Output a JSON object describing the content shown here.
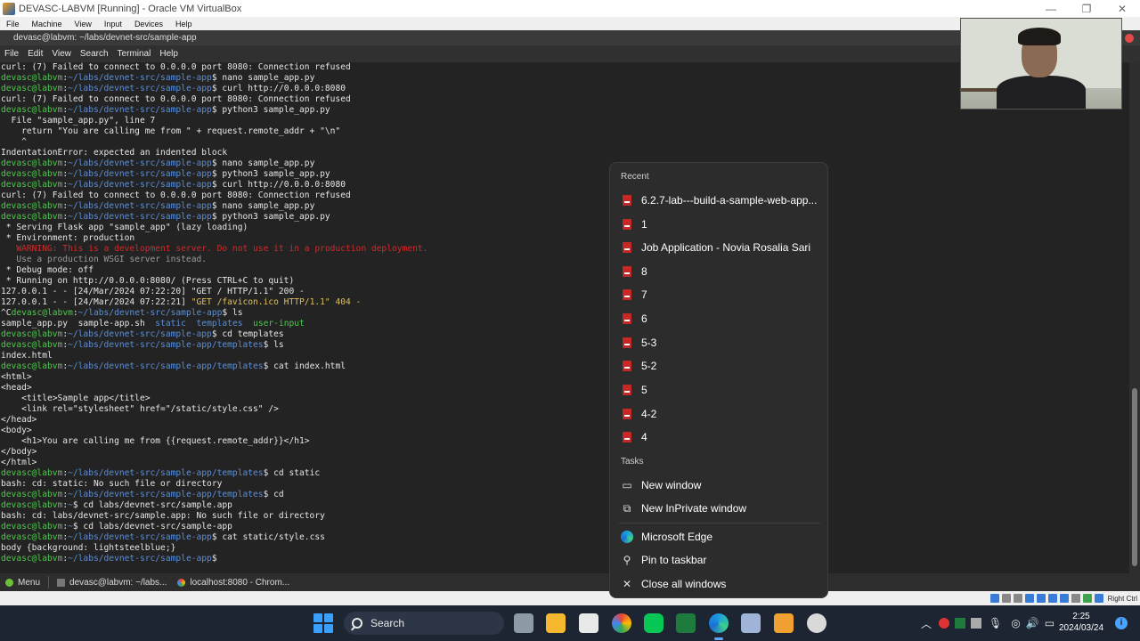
{
  "virtualbox": {
    "title": "DEVASC-LABVM [Running] - Oracle VM VirtualBox",
    "menu": [
      "File",
      "Machine",
      "View",
      "Input",
      "Devices",
      "Help"
    ],
    "host_key": "Right Ctrl"
  },
  "terminal": {
    "title": "devasc@labvm: ~/labs/devnet-src/sample-app",
    "menu": [
      "File",
      "Edit",
      "View",
      "Search",
      "Terminal",
      "Help"
    ],
    "lines": [
      [
        {
          "t": "curl: (7) Failed to connect to 0.0.0.0 port 8080: Connection refused",
          "c": ""
        }
      ],
      [
        {
          "t": "devasc@labvm",
          "c": "user"
        },
        {
          "t": ":",
          "c": ""
        },
        {
          "t": "~/labs/devnet-src/sample-app",
          "c": "path"
        },
        {
          "t": "$ nano sample_app.py",
          "c": ""
        }
      ],
      [
        {
          "t": "devasc@labvm",
          "c": "user"
        },
        {
          "t": ":",
          "c": ""
        },
        {
          "t": "~/labs/devnet-src/sample-app",
          "c": "path"
        },
        {
          "t": "$ curl http://0.0.0.0:8080",
          "c": ""
        }
      ],
      [
        {
          "t": "curl: (7) Failed to connect to 0.0.0.0 port 8080: Connection refused",
          "c": ""
        }
      ],
      [
        {
          "t": "devasc@labvm",
          "c": "user"
        },
        {
          "t": ":",
          "c": ""
        },
        {
          "t": "~/labs/devnet-src/sample-app",
          "c": "path"
        },
        {
          "t": "$ python3 sample_app.py",
          "c": ""
        }
      ],
      [
        {
          "t": "  File \"sample_app.py\", line 7",
          "c": ""
        }
      ],
      [
        {
          "t": "    return \"You are calling me from \" + request.remote_addr + \"\\n\"",
          "c": ""
        }
      ],
      [
        {
          "t": "    ^",
          "c": ""
        }
      ],
      [
        {
          "t": "IndentationError: expected an indented block",
          "c": ""
        }
      ],
      [
        {
          "t": "devasc@labvm",
          "c": "user"
        },
        {
          "t": ":",
          "c": ""
        },
        {
          "t": "~/labs/devnet-src/sample-app",
          "c": "path"
        },
        {
          "t": "$ nano sample_app.py",
          "c": ""
        }
      ],
      [
        {
          "t": "devasc@labvm",
          "c": "user"
        },
        {
          "t": ":",
          "c": ""
        },
        {
          "t": "~/labs/devnet-src/sample-app",
          "c": "path"
        },
        {
          "t": "$ python3 sample_app.py",
          "c": ""
        }
      ],
      [
        {
          "t": "devasc@labvm",
          "c": "user"
        },
        {
          "t": ":",
          "c": ""
        },
        {
          "t": "~/labs/devnet-src/sample-app",
          "c": "path"
        },
        {
          "t": "$ curl http://0.0.0.0:8080",
          "c": ""
        }
      ],
      [
        {
          "t": "curl: (7) Failed to connect to 0.0.0.0 port 8080: Connection refused",
          "c": ""
        }
      ],
      [
        {
          "t": "devasc@labvm",
          "c": "user"
        },
        {
          "t": ":",
          "c": ""
        },
        {
          "t": "~/labs/devnet-src/sample-app",
          "c": "path"
        },
        {
          "t": "$ nano sample_app.py",
          "c": ""
        }
      ],
      [
        {
          "t": "devasc@labvm",
          "c": "user"
        },
        {
          "t": ":",
          "c": ""
        },
        {
          "t": "~/labs/devnet-src/sample-app",
          "c": "path"
        },
        {
          "t": "$ python3 sample_app.py",
          "c": ""
        }
      ],
      [
        {
          "t": " * Serving Flask app \"sample_app\" (lazy loading)",
          "c": ""
        }
      ],
      [
        {
          "t": " * Environment: production",
          "c": ""
        }
      ],
      [
        {
          "t": "   WARNING: This is a development server. Do not use it in a production deployment.",
          "c": "warn"
        }
      ],
      [
        {
          "t": "   Use a production WSGI server instead.",
          "c": "dim"
        }
      ],
      [
        {
          "t": " * Debug mode: off",
          "c": ""
        }
      ],
      [
        {
          "t": " * Running on http://0.0.0.0:8080/ (Press CTRL+C to quit)",
          "c": ""
        }
      ],
      [
        {
          "t": "127.0.0.1 - - [24/Mar/2024 07:22:20] \"GET / HTTP/1.1\" 200 -",
          "c": ""
        }
      ],
      [
        {
          "t": "127.0.0.1 - - [24/Mar/2024 07:22:21] ",
          "c": ""
        },
        {
          "t": "\"GET /favicon.ico HTTP/1.1\" 404 -",
          "c": "404"
        }
      ],
      [
        {
          "t": "^C",
          "c": ""
        },
        {
          "t": "devasc@labvm",
          "c": "user"
        },
        {
          "t": ":",
          "c": ""
        },
        {
          "t": "~/labs/devnet-src/sample-app",
          "c": "path"
        },
        {
          "t": "$ ls",
          "c": ""
        }
      ],
      [
        {
          "t": "sample_app.py  ",
          "c": ""
        },
        {
          "t": "sample-app.sh",
          "c": ""
        },
        {
          "t": "  ",
          "c": ""
        },
        {
          "t": "static",
          "c": "dir"
        },
        {
          "t": "  ",
          "c": ""
        },
        {
          "t": "templates",
          "c": "dir"
        },
        {
          "t": "  ",
          "c": ""
        },
        {
          "t": "user-input",
          "c": "exe"
        }
      ],
      [
        {
          "t": "devasc@labvm",
          "c": "user"
        },
        {
          "t": ":",
          "c": ""
        },
        {
          "t": "~/labs/devnet-src/sample-app",
          "c": "path"
        },
        {
          "t": "$ cd templates",
          "c": ""
        }
      ],
      [
        {
          "t": "devasc@labvm",
          "c": "user"
        },
        {
          "t": ":",
          "c": ""
        },
        {
          "t": "~/labs/devnet-src/sample-app/templates",
          "c": "path"
        },
        {
          "t": "$ ls",
          "c": ""
        }
      ],
      [
        {
          "t": "index.html",
          "c": ""
        }
      ],
      [
        {
          "t": "devasc@labvm",
          "c": "user"
        },
        {
          "t": ":",
          "c": ""
        },
        {
          "t": "~/labs/devnet-src/sample-app/templates",
          "c": "path"
        },
        {
          "t": "$ cat index.html",
          "c": ""
        }
      ],
      [
        {
          "t": "<html>",
          "c": ""
        }
      ],
      [
        {
          "t": "<head>",
          "c": ""
        }
      ],
      [
        {
          "t": "    <title>Sample app</title>",
          "c": ""
        }
      ],
      [
        {
          "t": "    <link rel=\"stylesheet\" href=\"/static/style.css\" />",
          "c": ""
        }
      ],
      [
        {
          "t": "</head>",
          "c": ""
        }
      ],
      [
        {
          "t": "<body>",
          "c": ""
        }
      ],
      [
        {
          "t": "    <h1>You are calling me from {{request.remote_addr}}</h1>",
          "c": ""
        }
      ],
      [
        {
          "t": "</body>",
          "c": ""
        }
      ],
      [
        {
          "t": "</html>",
          "c": ""
        }
      ],
      [
        {
          "t": "devasc@labvm",
          "c": "user"
        },
        {
          "t": ":",
          "c": ""
        },
        {
          "t": "~/labs/devnet-src/sample-app/templates",
          "c": "path"
        },
        {
          "t": "$ cd static",
          "c": ""
        }
      ],
      [
        {
          "t": "bash: cd: static: No such file or directory",
          "c": ""
        }
      ],
      [
        {
          "t": "devasc@labvm",
          "c": "user"
        },
        {
          "t": ":",
          "c": ""
        },
        {
          "t": "~/labs/devnet-src/sample-app/templates",
          "c": "path"
        },
        {
          "t": "$ cd",
          "c": ""
        }
      ],
      [
        {
          "t": "devasc@labvm",
          "c": "user"
        },
        {
          "t": ":",
          "c": ""
        },
        {
          "t": "~",
          "c": "path"
        },
        {
          "t": "$ cd labs/devnet-src/sample.app",
          "c": ""
        }
      ],
      [
        {
          "t": "bash: cd: labs/devnet-src/sample.app: No such file or directory",
          "c": ""
        }
      ],
      [
        {
          "t": "devasc@labvm",
          "c": "user"
        },
        {
          "t": ":",
          "c": ""
        },
        {
          "t": "~",
          "c": "path"
        },
        {
          "t": "$ cd labs/devnet-src/sample-app",
          "c": ""
        }
      ],
      [
        {
          "t": "devasc@labvm",
          "c": "user"
        },
        {
          "t": ":",
          "c": ""
        },
        {
          "t": "~/labs/devnet-src/sample-app",
          "c": "path"
        },
        {
          "t": "$ cat static/style.css",
          "c": ""
        }
      ],
      [
        {
          "t": "body {background: lightsteelblue;}",
          "c": ""
        }
      ],
      [
        {
          "t": "devasc@labvm",
          "c": "user"
        },
        {
          "t": ":",
          "c": ""
        },
        {
          "t": "~/labs/devnet-src/sample-app",
          "c": "path"
        },
        {
          "t": "$ ",
          "c": ""
        }
      ]
    ]
  },
  "guest_panel": {
    "menu_label": "Menu",
    "items": [
      {
        "label": "devasc@labvm: ~/labs..."
      },
      {
        "label": "localhost:8080 - Chrom..."
      }
    ]
  },
  "jump_list": {
    "recent_heading": "Recent",
    "recent": [
      "6.2.7-lab---build-a-sample-web-app...",
      "1",
      "Job Application - Novia Rosalia Sari",
      "8",
      "7",
      "6",
      "5-3",
      "5-2",
      "5",
      "4-2",
      "4"
    ],
    "tasks_heading": "Tasks",
    "tasks": [
      {
        "label": "New window",
        "icon": "window-icon"
      },
      {
        "label": "New InPrivate window",
        "icon": "inprivate-icon"
      }
    ],
    "app_actions": [
      {
        "label": "Microsoft Edge",
        "icon": "edge-icon"
      },
      {
        "label": "Pin to taskbar",
        "icon": "pin-icon"
      },
      {
        "label": "Close all windows",
        "icon": "close-icon"
      }
    ]
  },
  "taskbar": {
    "search_label": "Search",
    "time": "2:25",
    "date": "2024/03/24"
  },
  "colors": {
    "prompt_user": "#4ec94e",
    "prompt_path": "#5b8fd6",
    "warning": "#d02a2a",
    "accent": "#60a5fa"
  }
}
